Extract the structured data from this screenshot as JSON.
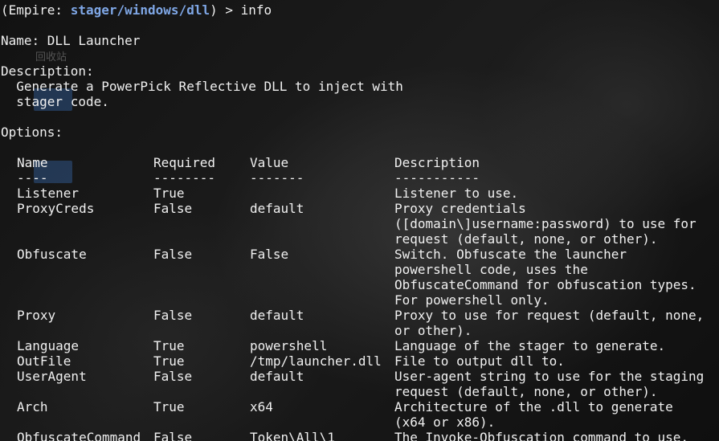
{
  "desktop": {
    "recycle_label": "回收站"
  },
  "prompt": {
    "open": "(Empire: ",
    "module": "stager/windows/dll",
    "close": ") > ",
    "command": "info"
  },
  "module_info": {
    "name_line": "Name: DLL Launcher",
    "description_header": "Description:",
    "description_lines": [
      "  Generate a PowerPick Reflective DLL to inject with",
      "  stager code."
    ],
    "options_header": "Options:"
  },
  "options_table": {
    "headers": [
      "Name",
      "Required",
      "Value",
      "Description"
    ],
    "underlines": [
      "----",
      "--------",
      "-------",
      "-----------"
    ],
    "rows": [
      {
        "name": "Listener",
        "required": "True",
        "value": "",
        "description": [
          "Listener to use."
        ]
      },
      {
        "name": "ProxyCreds",
        "required": "False",
        "value": "default",
        "description": [
          "Proxy credentials",
          "([domain\\]username:password) to use for",
          "request (default, none, or other)."
        ]
      },
      {
        "name": "Obfuscate",
        "required": "False",
        "value": "False",
        "description": [
          "Switch. Obfuscate the launcher",
          "powershell code, uses the",
          "ObfuscateCommand for obfuscation types.",
          "For powershell only."
        ]
      },
      {
        "name": "Proxy",
        "required": "False",
        "value": "default",
        "description": [
          "Proxy to use for request (default, none,",
          "or other)."
        ]
      },
      {
        "name": "Language",
        "required": "True",
        "value": "powershell",
        "description": [
          "Language of the stager to generate."
        ]
      },
      {
        "name": "OutFile",
        "required": "True",
        "value": "/tmp/launcher.dll",
        "description": [
          "File to output dll to."
        ]
      },
      {
        "name": "UserAgent",
        "required": "False",
        "value": "default",
        "description": [
          "User-agent string to use for the staging",
          "request (default, none, or other)."
        ]
      },
      {
        "name": "Arch",
        "required": "True",
        "value": "x64",
        "description": [
          "Architecture of the .dll to generate",
          "(x64 or x86)."
        ]
      },
      {
        "name": "ObfuscateCommand",
        "required": "False",
        "value": "Token\\All\\1",
        "description": [
          "The Invoke-Obfuscation command to use."
        ]
      }
    ]
  }
}
